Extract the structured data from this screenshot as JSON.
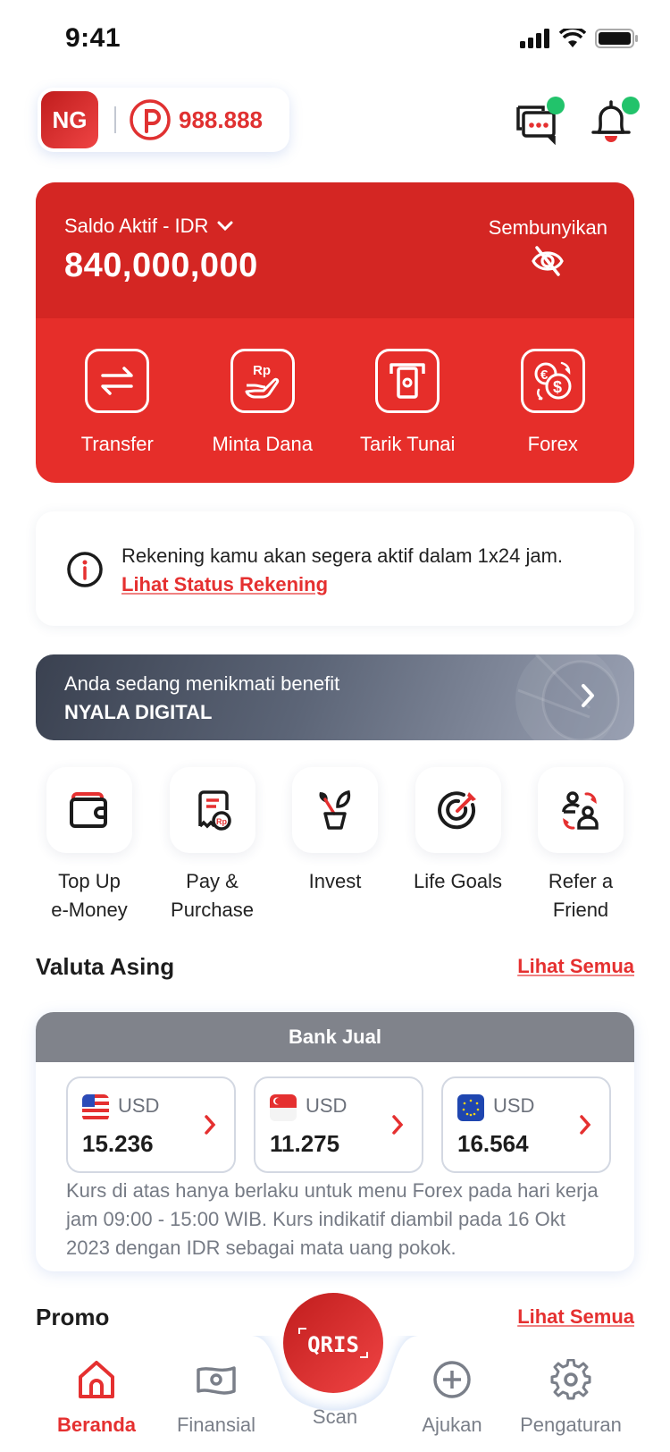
{
  "status_bar": {
    "time": "9:41"
  },
  "header": {
    "avatar_initials": "NG",
    "points": "988.888",
    "icons": [
      "chat-icon",
      "bell-icon"
    ]
  },
  "balance": {
    "label": "Saldo Aktif - IDR",
    "amount": "840,000,000",
    "hide_label": "Sembunyikan"
  },
  "quick_actions": [
    {
      "label": "Transfer",
      "icon": "transfer-icon"
    },
    {
      "label": "Minta Dana",
      "icon": "request-money-icon"
    },
    {
      "label": "Tarik Tunai",
      "icon": "atm-withdraw-icon"
    },
    {
      "label": "Forex",
      "icon": "forex-icon"
    }
  ],
  "info": {
    "message": "Rekening kamu akan segera aktif dalam 1x24 jam.",
    "link": "Lihat Status Rekening"
  },
  "benefit": {
    "line1": "Anda sedang menikmati benefit",
    "line2": "NYALA DIGITAL"
  },
  "shortcuts": [
    {
      "label": "Top Up\ne-Money",
      "icon": "wallet-icon"
    },
    {
      "label": "Pay &\nPurchase",
      "icon": "bill-icon"
    },
    {
      "label": "Invest",
      "icon": "plant-icon"
    },
    {
      "label": "Life Goals",
      "icon": "target-icon"
    },
    {
      "label": "Refer a\nFriend",
      "icon": "refer-icon"
    }
  ],
  "valuta": {
    "title": "Valuta Asing",
    "see_all": "Lihat Semua",
    "tab": "Bank Jual",
    "rates": [
      {
        "flag": "us-flag",
        "code": "USD",
        "value": "15.236"
      },
      {
        "flag": "sg-flag",
        "code": "USD",
        "value": "11.275"
      },
      {
        "flag": "eu-flag",
        "code": "USD",
        "value": "16.564"
      }
    ],
    "note": "Kurs di atas hanya berlaku untuk menu Forex pada hari kerja jam 09:00 - 15:00 WIB. Kurs indikatif diambil pada 16 Okt 2023 dengan IDR sebagai mata uang pokok."
  },
  "promo": {
    "title": "Promo",
    "see_all": "Lihat Semua"
  },
  "bottom_nav": {
    "items": [
      {
        "label": "Beranda",
        "active": true
      },
      {
        "label": "Finansial",
        "active": false
      },
      {
        "label": "Scan",
        "active": false
      },
      {
        "label": "Ajukan",
        "active": false
      },
      {
        "label": "Pengaturan",
        "active": false
      }
    ],
    "scan_logo": "QRIS"
  },
  "colors": {
    "brand_red": "#e62e2a",
    "brand_red_dark": "#d42623",
    "link_red": "#e53030",
    "notification_green": "#22c36b",
    "fx_header_gray": "#80838b"
  }
}
